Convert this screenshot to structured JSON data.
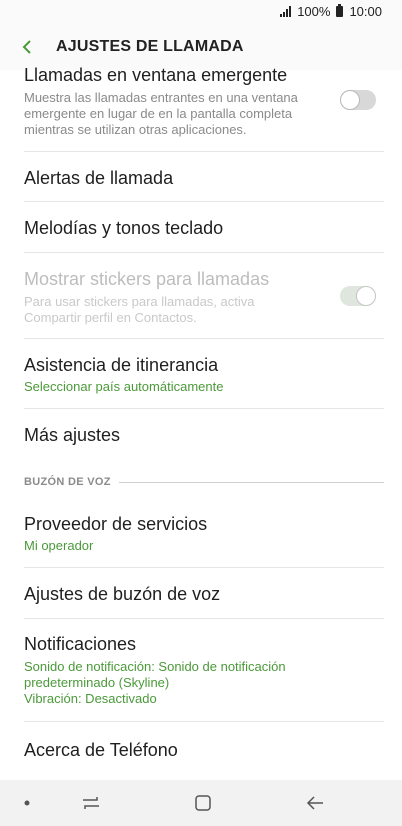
{
  "status_bar": {
    "battery": "100%",
    "time": "10:00"
  },
  "header": {
    "title": "AJUSTES DE LLAMADA"
  },
  "items": [
    {
      "title": "Llamadas en ventana emergente",
      "subtitle_lines": [
        "Muestra las llamadas entrantes en una ventana",
        "emergente en lugar de en la pantalla completa",
        "mientras se utilizan otras aplicaciones."
      ],
      "toggle": "off"
    },
    {
      "title": "Alertas de llamada"
    },
    {
      "title": "Melodías y tonos teclado"
    },
    {
      "title": "Mostrar stickers para llamadas",
      "subtitle_lines": [
        "Para usar stickers para llamadas, activa",
        "Compartir perfil en Contactos."
      ],
      "toggle": "on",
      "disabled": true
    },
    {
      "title": "Asistencia de itinerancia",
      "subtitle": "Seleccionar país automáticamente"
    },
    {
      "title": "Más ajustes"
    }
  ],
  "voicemail_section": {
    "header": "BUZÓN DE VOZ",
    "items": [
      {
        "title": "Proveedor de servicios",
        "subtitle": "Mi operador"
      },
      {
        "title": "Ajustes de buzón de voz"
      },
      {
        "title": "Notificaciones",
        "subtitle_lines": [
          "Sonido de notificación: Sonido de notificación",
          "predeterminado (Skyline)",
          "Vibración: Desactivado"
        ]
      },
      {
        "title": "Acerca de Teléfono"
      }
    ]
  },
  "colors": {
    "accent": "#4b9a3a",
    "nav_background": "#f2f2f2"
  },
  "nav_bar": {
    "icons": [
      "dot-icon",
      "recents-icon",
      "home-icon",
      "back-icon"
    ]
  }
}
